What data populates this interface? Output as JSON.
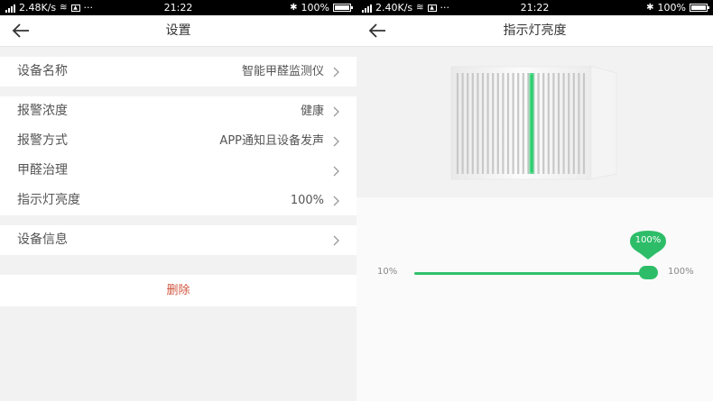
{
  "colors": {
    "accent": "#31c06c",
    "delete": "#d0553f",
    "statusbar": "#000000"
  },
  "left_status": {
    "speed": "2.48K/s",
    "dots": "···",
    "time": "21:22",
    "battery": "100%"
  },
  "right_status": {
    "speed": "2.40K/s",
    "dots": "···",
    "time": "21:22",
    "battery": "100%"
  },
  "settings": {
    "title": "设置",
    "group1": [
      {
        "label": "设备名称",
        "value": "智能甲醛监测仪"
      }
    ],
    "group2": [
      {
        "label": "报警浓度",
        "value": "健康"
      },
      {
        "label": "报警方式",
        "value": "APP通知且设备发声"
      },
      {
        "label": "甲醛治理",
        "value": ""
      },
      {
        "label": "指示灯亮度",
        "value": "100%"
      }
    ],
    "group3": [
      {
        "label": "设备信息",
        "value": ""
      }
    ],
    "delete_label": "删除"
  },
  "brightness": {
    "title": "指示灯亮度",
    "min_label": "10%",
    "max_label": "100%",
    "current_label": "100%",
    "value_fraction": 1.0
  },
  "icons": [
    "back-arrow-icon",
    "chevron-right-icon",
    "signal-icon",
    "wifi-icon",
    "bluetooth-icon",
    "battery-icon"
  ]
}
